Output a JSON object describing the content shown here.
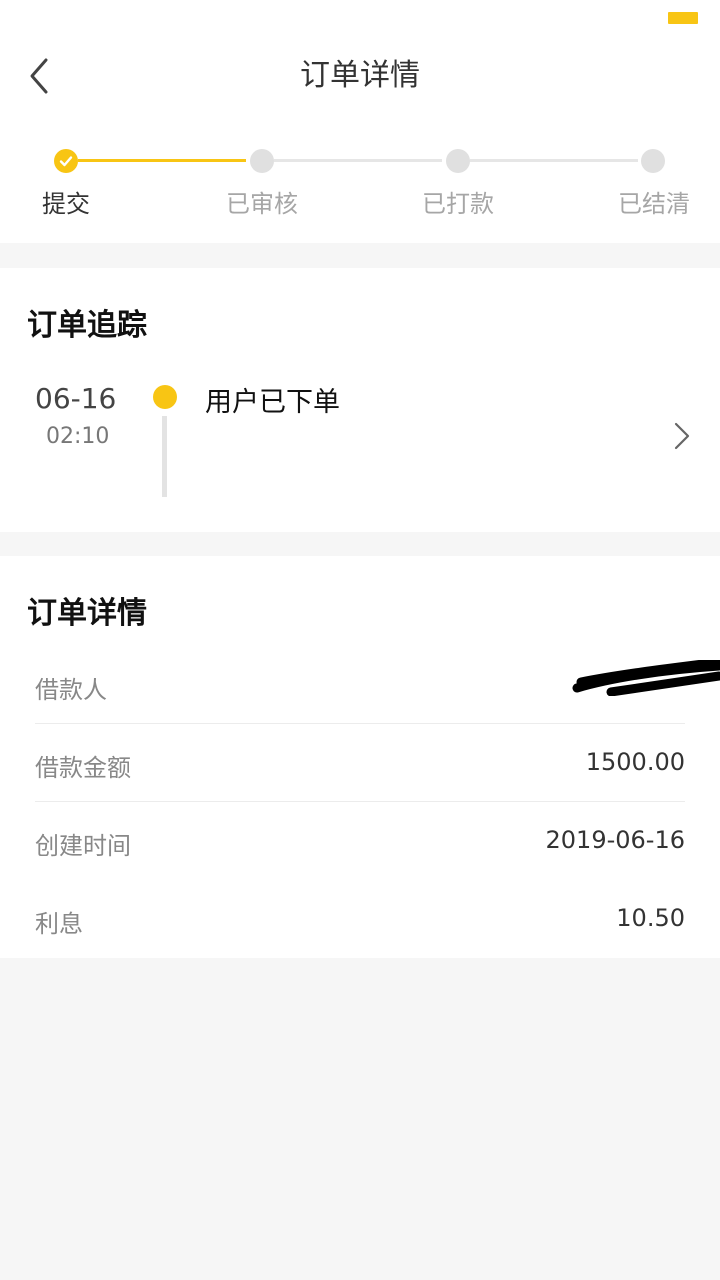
{
  "header": {
    "title": "订单详情"
  },
  "steps": [
    {
      "label": "提交",
      "done": true
    },
    {
      "label": "已审核",
      "done": false
    },
    {
      "label": "已打款",
      "done": false
    },
    {
      "label": "已结清",
      "done": false
    }
  ],
  "tracking": {
    "title": "订单追踪",
    "items": [
      {
        "date": "06-16",
        "time": "02:10",
        "event": "用户已下单"
      }
    ]
  },
  "details": {
    "title": "订单详情",
    "rows": [
      {
        "label": "借款人",
        "value": ""
      },
      {
        "label": "借款金额",
        "value": "1500.00"
      },
      {
        "label": "创建时间",
        "value": "2019-06-16"
      },
      {
        "label": "利息",
        "value": "10.50"
      }
    ]
  },
  "colors": {
    "accent": "#f8c514",
    "inactive": "#e0e0e0",
    "background": "#f6f6f6"
  },
  "icons": {
    "back": "chevron-left-icon",
    "check": "check-icon",
    "more": "chevron-right-icon"
  }
}
